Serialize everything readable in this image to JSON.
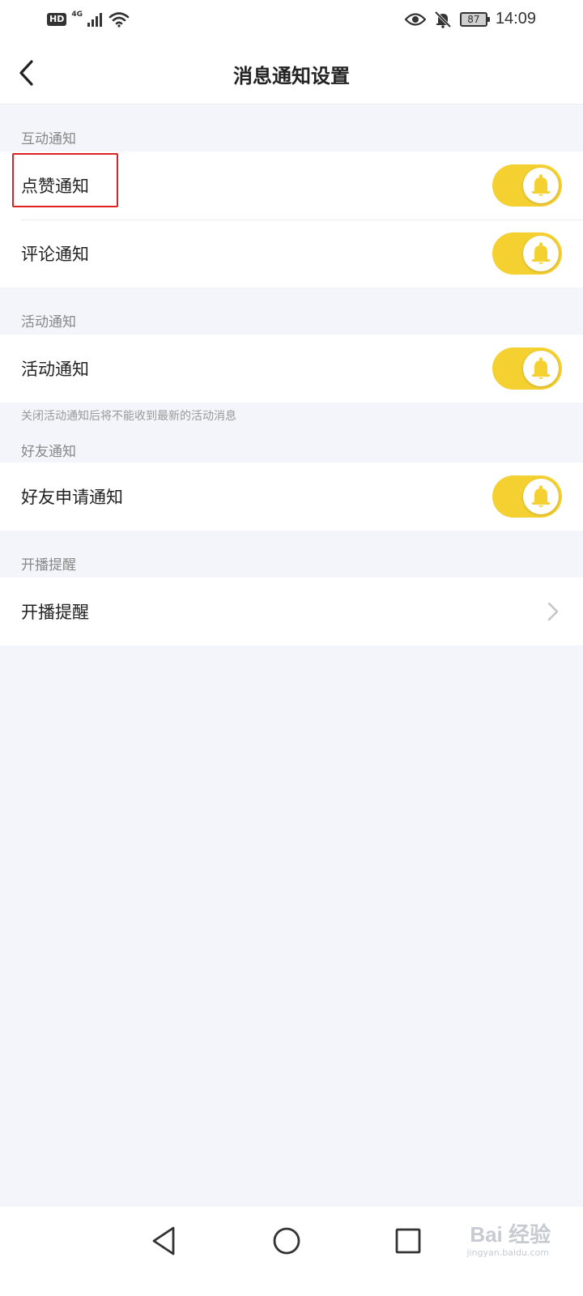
{
  "status_bar": {
    "hd": "HD",
    "network": "4G",
    "battery": "87",
    "time": "14:09",
    "icons": [
      "signal-icon",
      "wifi-icon",
      "eye-icon",
      "bell-off-icon",
      "battery-icon"
    ]
  },
  "header": {
    "title": "消息通知设置",
    "back_icon": "back-arrow-icon"
  },
  "sections": {
    "interaction": {
      "header": "互动通知",
      "items": [
        {
          "label": "点赞通知",
          "toggle_on": true
        },
        {
          "label": "评论通知",
          "toggle_on": true
        }
      ]
    },
    "activity": {
      "header": "活动通知",
      "items": [
        {
          "label": "活动通知",
          "toggle_on": true
        }
      ],
      "note": "关闭活动通知后将不能收到最新的活动消息"
    },
    "friends": {
      "header": "好友通知",
      "items": [
        {
          "label": "好友申请通知",
          "toggle_on": true
        }
      ]
    },
    "live": {
      "header": "开播提醒",
      "items": [
        {
          "label": "开播提醒",
          "icon": "chevron-right-icon"
        }
      ]
    }
  },
  "colors": {
    "toggle_on": "#f5d031",
    "bell": "#f5d031",
    "highlight": "#e02020",
    "background": "#f4f5fa"
  },
  "watermark": {
    "text": "Bai 经验",
    "sub": "jingyan.baidu.com"
  }
}
